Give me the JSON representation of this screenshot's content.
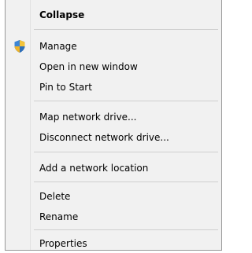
{
  "context_menu": {
    "items": [
      {
        "label": "Collapse"
      },
      {
        "label": "Manage",
        "icon": "uac-shield-icon"
      },
      {
        "label": "Open in new window"
      },
      {
        "label": "Pin to Start"
      },
      {
        "label": "Map network drive..."
      },
      {
        "label": "Disconnect network drive..."
      },
      {
        "label": "Add a network location"
      },
      {
        "label": "Delete"
      },
      {
        "label": "Rename"
      },
      {
        "label": "Properties"
      }
    ]
  },
  "colors": {
    "menu_background": "#f1f1f1",
    "border": "#979797",
    "separator": "#cfcfcf"
  }
}
